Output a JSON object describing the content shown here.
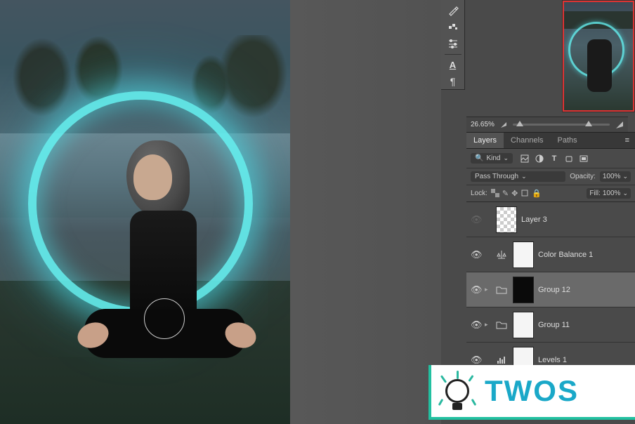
{
  "toolbar": {
    "items": [
      {
        "name": "brush-panel-icon",
        "glyph": "brush"
      },
      {
        "name": "swatches-icon",
        "glyph": "swatch"
      },
      {
        "name": "paragraph-icon",
        "glyph": "para"
      },
      {
        "name": "character-icon",
        "glyph": "A"
      },
      {
        "name": "pilcrow-icon",
        "glyph": "¶"
      }
    ]
  },
  "navigator": {
    "zoom_value": "26.65%"
  },
  "tabs": {
    "active": "Layers",
    "items": [
      "Layers",
      "Channels",
      "Paths"
    ]
  },
  "filter": {
    "search_label": "Kind",
    "filter_icons": [
      "image",
      "adjust",
      "type",
      "shape",
      "smart"
    ]
  },
  "blend": {
    "mode": "Pass Through",
    "opacity_label": "Opacity:",
    "opacity_value": "100%"
  },
  "lock": {
    "label": "Lock:",
    "fill_label": "Fill:",
    "fill_value": "100%"
  },
  "layers": [
    {
      "id": "layer3",
      "visible": false,
      "expand": null,
      "icon": null,
      "thumb": "checker",
      "mask": null,
      "name": "Layer 3",
      "selected": false
    },
    {
      "id": "colorbalance",
      "visible": true,
      "expand": null,
      "icon": "balance",
      "thumb": "white",
      "mask": "link",
      "name": "Color Balance 1",
      "selected": false
    },
    {
      "id": "group12",
      "visible": true,
      "expand": "closed",
      "icon": "folder",
      "thumb": "dark",
      "mask": null,
      "name": "Group 12",
      "selected": true
    },
    {
      "id": "group11",
      "visible": true,
      "expand": "closed",
      "icon": "folder",
      "thumb": "white",
      "mask": null,
      "name": "Group 11",
      "selected": false
    },
    {
      "id": "levels1",
      "visible": true,
      "expand": null,
      "icon": "levels",
      "thumb": "white",
      "mask": "link",
      "name": "Levels 1",
      "selected": false
    }
  ],
  "badge": {
    "text": "TWOS"
  }
}
